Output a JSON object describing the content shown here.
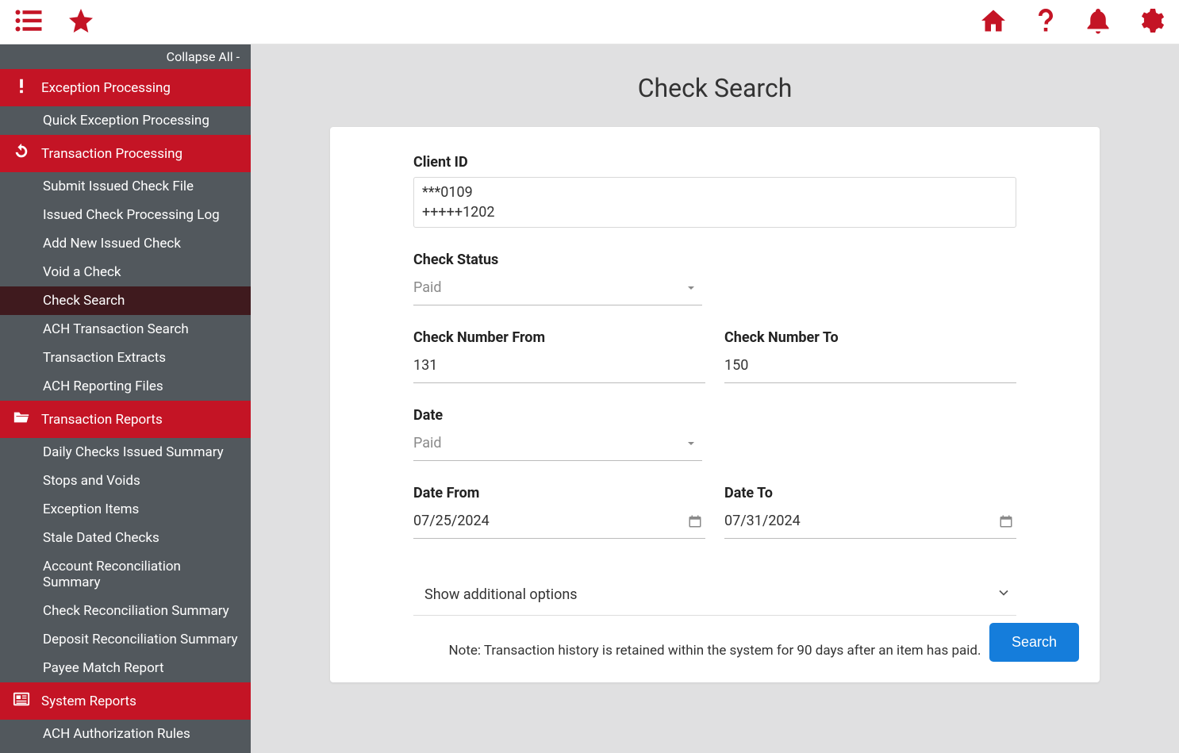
{
  "sidebar": {
    "collapse_label": "Collapse All -",
    "sections": [
      {
        "label": "Exception Processing",
        "items": [
          "Quick Exception Processing"
        ]
      },
      {
        "label": "Transaction Processing",
        "items": [
          "Submit Issued Check File",
          "Issued Check Processing Log",
          "Add New Issued Check",
          "Void a Check",
          "Check Search",
          "ACH Transaction Search",
          "Transaction Extracts",
          "ACH Reporting Files"
        ],
        "active_index": 4
      },
      {
        "label": "Transaction Reports",
        "items": [
          "Daily Checks Issued Summary",
          "Stops and Voids",
          "Exception Items",
          "Stale Dated Checks",
          "Account Reconciliation Summary",
          "Check Reconciliation Summary",
          "Deposit Reconciliation Summary",
          "Payee Match Report"
        ]
      },
      {
        "label": "System Reports",
        "items": [
          "ACH Authorization Rules"
        ]
      }
    ]
  },
  "page_title": "Check Search",
  "form": {
    "client_id_label": "Client ID",
    "client_ids": [
      "***0109",
      "+++++1202"
    ],
    "check_status_label": "Check Status",
    "check_status_value": "Paid",
    "check_num_from_label": "Check Number From",
    "check_num_from_value": "131",
    "check_num_to_label": "Check Number To",
    "check_num_to_value": "150",
    "date_label": "Date",
    "date_type_value": "Paid",
    "date_from_label": "Date From",
    "date_from_value": "07/25/2024",
    "date_to_label": "Date To",
    "date_to_value": "07/31/2024",
    "additional_options_label": "Show additional options",
    "note_text": "Note: Transaction history is retained within the system for 90 days after an item has paid.",
    "search_button_label": "Search"
  }
}
